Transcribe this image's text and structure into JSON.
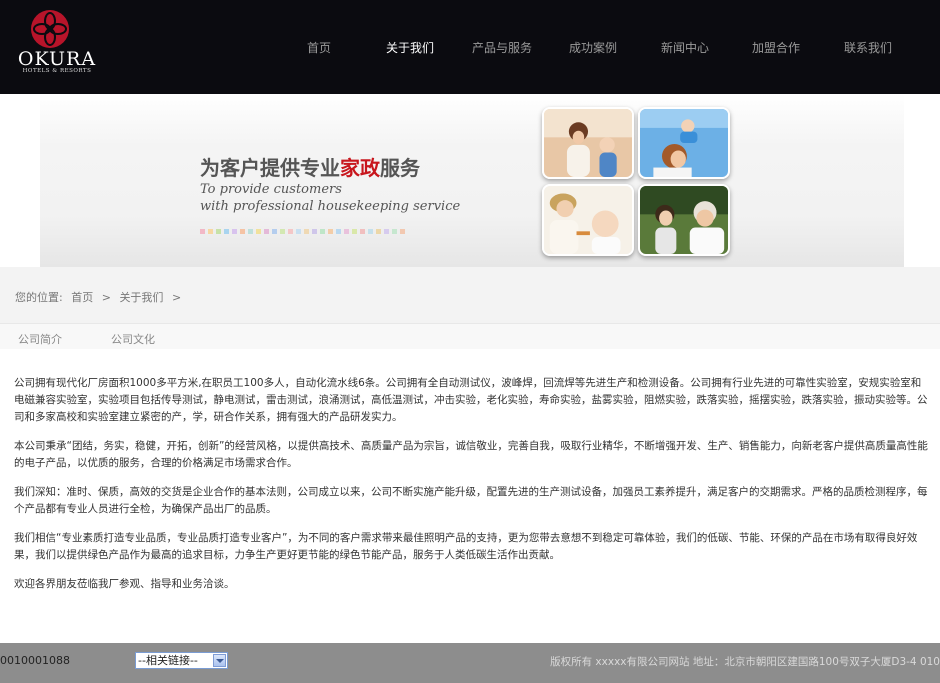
{
  "header": {
    "logo_text": "OKURA",
    "logo_sub": "HOTELS & RESORTS",
    "nav": [
      {
        "label": "首页",
        "active": false
      },
      {
        "label": "关于我们",
        "active": true
      },
      {
        "label": "产品与服务",
        "active": false
      },
      {
        "label": "成功案例",
        "active": false
      },
      {
        "label": "新闻中心",
        "active": false
      },
      {
        "label": "加盟合作",
        "active": false
      },
      {
        "label": "联系我们",
        "active": false
      }
    ]
  },
  "banner": {
    "headline_pre": "为客户提供专业",
    "headline_highlight": "家政",
    "headline_post": "服务",
    "en_line1": "To provide customers",
    "en_line2": "with professional housekeeping service",
    "accent_color": "#c8161d"
  },
  "breadcrumb": {
    "prefix": "您的位置:",
    "items": [
      "首页",
      ">",
      "关于我们",
      ">"
    ]
  },
  "tabs": [
    "公司简介",
    "公司文化"
  ],
  "content": {
    "paragraphs": [
      "公司拥有现代化厂房面积1000多平方米,在职员工100多人，自动化流水线6条。公司拥有全自动测试仪，波峰焊，回流焊等先进生产和检测设备。公司拥有行业先进的可靠性实验室，安规实验室和电磁兼容实验室，实验项目包括传导测试，静电测试，雷击测试，浪涌测试，高低温测试，冲击实验，老化实验，寿命实验，盐雾实验，阻燃实验，跌落实验，摇摆实验，跌落实验，振动实验等。公司和多家高校和实验室建立紧密的产，学，研合作关系，拥有强大的产品研发实力。",
      "本公司秉承“团结，务实，稳健，开拓，创新”的经营风格，以提供高技术、高质量产品为宗旨，诚信敬业，完善自我，吸取行业精华，不断增强开发、生产、销售能力，向新老客户提供高质量高性能的电子产品，以优质的服务，合理的价格满足市场需求合作。",
      "我们深知：准时、保质，高效的交货是企业合作的基本法则，公司成立以来，公司不断实施产能升级，配置先进的生产测试设备，加强员工素养提升，满足客户的交期需求。严格的品质检测程序，每个产品都有专业人员进行全检，为确保产品出厂的品质。",
      "我们相信“专业素质打造专业品质，专业品质打造专业客户”，为不同的客户需求带来最佳照明产品的支持，更为您带去意想不到稳定可靠体验，我们的低碳、节能、环保的产品在市场有取得良好效果，我们以提供绿色产品作为最高的追求目标，力争生产更好更节能的绿色节能产品，服务于人类低碳生活作出贡献。",
      "欢迎各界朋友莅临我厂参观、指导和业务洽谈。"
    ]
  },
  "footer": {
    "phone": "0010001088",
    "related_links_selected": "--相关链接--",
    "copyright": "版权所有 xxxxx有限公司网站 地址：北京市朝阳区建国路100号双子大厦D3-4 010"
  }
}
